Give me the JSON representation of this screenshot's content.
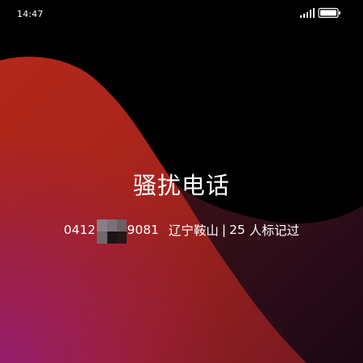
{
  "status_bar": {
    "time": "14:47",
    "signal_icon": "signal-bars-icon",
    "battery_icon": "battery-icon"
  },
  "call": {
    "title": "骚扰电话",
    "number_prefix": "0412",
    "number_suffix": "9081",
    "location": "辽宁鞍山",
    "separator": "|",
    "report_count": "25",
    "report_label": "人标记过"
  },
  "colors": {
    "background": "#000000",
    "wallpaper_red": "#b62418",
    "wallpaper_magenta": "#8e1d70",
    "text": "#ffffff"
  }
}
